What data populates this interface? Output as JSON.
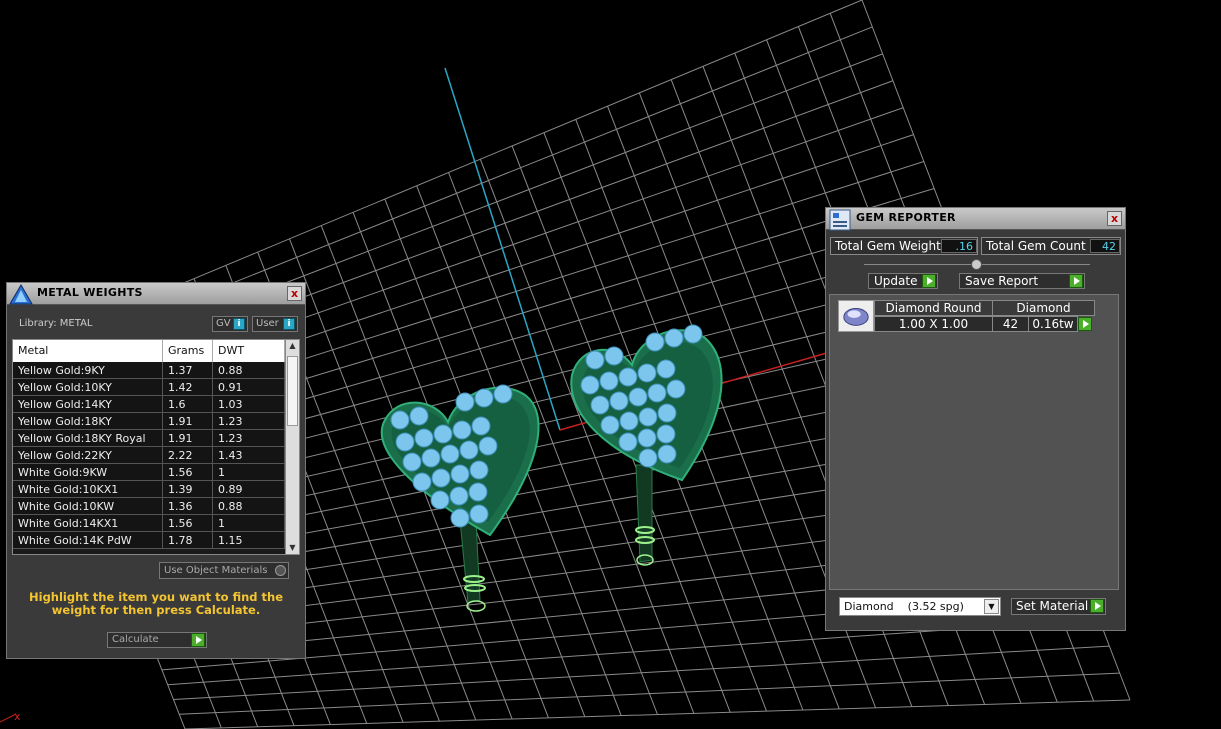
{
  "metal_weights": {
    "title": "METAL WEIGHTS",
    "library_label": "Library: METAL",
    "toggle_gv": "GV",
    "toggle_user": "User",
    "columns": [
      "Metal",
      "Grams",
      "DWT"
    ],
    "rows": [
      [
        "Yellow Gold:9KY",
        "1.37",
        "0.88"
      ],
      [
        "Yellow Gold:10KY",
        "1.42",
        "0.91"
      ],
      [
        "Yellow Gold:14KY",
        "1.6",
        "1.03"
      ],
      [
        "Yellow Gold:18KY",
        "1.91",
        "1.23"
      ],
      [
        "Yellow Gold:18KY Royal",
        "1.91",
        "1.23"
      ],
      [
        "Yellow Gold:22KY",
        "2.22",
        "1.43"
      ],
      [
        "White Gold:9KW",
        "1.56",
        "1"
      ],
      [
        "White Gold:10KX1",
        "1.39",
        "0.89"
      ],
      [
        "White Gold:10KW",
        "1.36",
        "0.88"
      ],
      [
        "White Gold:14KX1",
        "1.56",
        "1"
      ],
      [
        "White Gold:14K PdW",
        "1.78",
        "1.15"
      ]
    ],
    "use_object_materials": "Use Object Materials",
    "hint": "Highlight the item you want to find the weight for then press Calculate.",
    "calculate_label": "Calculate",
    "close": "x"
  },
  "gem_reporter": {
    "title": "GEM REPORTER",
    "total_gem_weight_label": "Total Gem Weight",
    "total_gem_weight_value": ".16",
    "total_gem_count_label": "Total Gem Count",
    "total_gem_count_value": "42",
    "update_label": "Update",
    "save_report_label": "Save Report",
    "gem_row": {
      "shape": "Diamond Round",
      "material": "Diamond",
      "size": "1.00 X 1.00",
      "count": "42",
      "weight": "0.16tw"
    },
    "material_select": "Diamond    (3.52 spg)",
    "set_material_label": "Set Material",
    "close": "x"
  },
  "viewport": {
    "axis_label": "x",
    "colors": {
      "grid": "#9a9a9a",
      "axis_y": "#2aa7c6",
      "axis_x": "#c62020",
      "metal": "#1d8a58",
      "gem": "#7cc6ee",
      "band": "#9cf08c"
    }
  }
}
